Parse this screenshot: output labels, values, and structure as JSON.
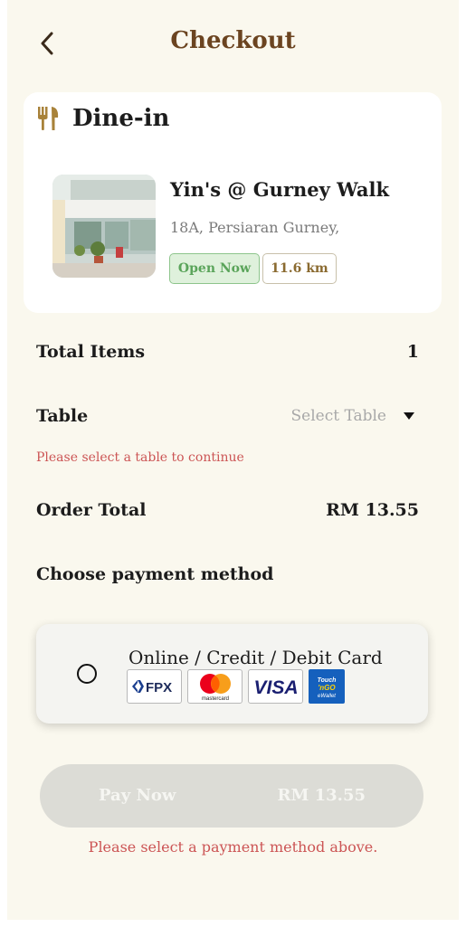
{
  "header": {
    "title": "Checkout",
    "back_icon": "chevron-left-icon"
  },
  "store": {
    "mode_icon": "fork-knife-icon",
    "mode_label": "Dine-in",
    "name": "Yin's @ Gurney Walk",
    "address": "18A, Persiaran Gurney,",
    "status": "Open Now",
    "distance": "11.6 km"
  },
  "summary": {
    "total_items_label": "Total Items",
    "total_items_value": "1",
    "table_label": "Table",
    "table_placeholder": "Select Table",
    "table_error": "Please select a table to continue",
    "order_total_label": "Order Total",
    "order_total_value": "RM 13.55"
  },
  "payment": {
    "section_title": "Choose payment method",
    "option_label": "Online / Credit / Debit Card",
    "logos": [
      "FPX",
      "mastercard",
      "VISA",
      "Touch 'n Go eWallet"
    ],
    "selected": false
  },
  "pay_button": {
    "label": "Pay Now",
    "amount": "RM 13.55"
  },
  "payment_error": "Please select a payment method above.",
  "colors": {
    "background": "#faf8ee",
    "brand_brown": "#6b4420",
    "icon_gold": "#a8823a",
    "error_red": "#cc5555",
    "open_green": "#5aa45a",
    "disabled_button": "#dcdcd6"
  }
}
